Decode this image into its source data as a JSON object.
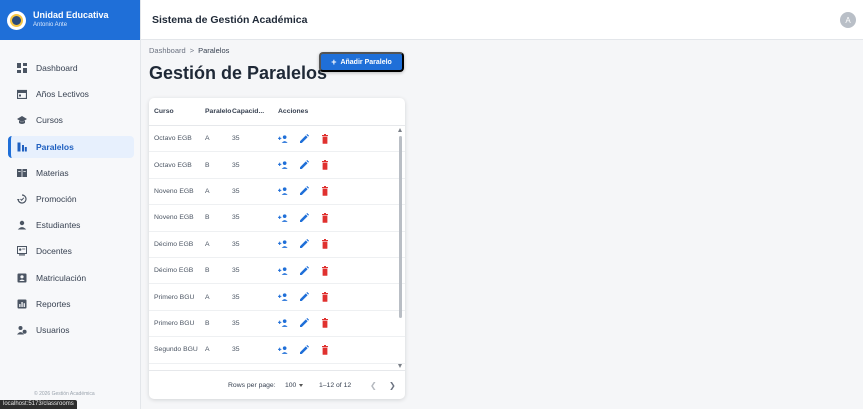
{
  "brand": {
    "title": "Unidad Educativa",
    "subtitle": "Antonio Ante"
  },
  "header": {
    "title": "Sistema de Gestión Académica",
    "avatar_initial": "A"
  },
  "sidebar": {
    "items": [
      {
        "label": "Dashboard",
        "icon": "dashboard-icon"
      },
      {
        "label": "Años Lectivos",
        "icon": "calendar-icon"
      },
      {
        "label": "Cursos",
        "icon": "school-icon"
      },
      {
        "label": "Paralelos",
        "icon": "classroom-icon",
        "active": true
      },
      {
        "label": "Materias",
        "icon": "book-icon"
      },
      {
        "label": "Promoción",
        "icon": "promotion-icon"
      },
      {
        "label": "Estudiantes",
        "icon": "student-icon"
      },
      {
        "label": "Docentes",
        "icon": "teacher-icon"
      },
      {
        "label": "Matriculación",
        "icon": "enrollment-icon"
      },
      {
        "label": "Reportes",
        "icon": "reports-icon"
      },
      {
        "label": "Usuarios",
        "icon": "users-icon"
      }
    ],
    "footer": "© 2026 Gestión Académica"
  },
  "breadcrumb": {
    "root": "Dashboard",
    "separator": ">",
    "current": "Paralelos"
  },
  "page": {
    "title": "Gestión de Paralelos",
    "add_button": "Añadir Paralelo"
  },
  "table": {
    "headers": {
      "curso": "Curso",
      "paralelo": "Paralelo",
      "capacidad": "Capacid...",
      "acciones": "Acciones"
    },
    "rows": [
      {
        "curso": "Octavo EGB",
        "paralelo": "A",
        "capacidad": "35"
      },
      {
        "curso": "Octavo EGB",
        "paralelo": "B",
        "capacidad": "35"
      },
      {
        "curso": "Noveno EGB",
        "paralelo": "A",
        "capacidad": "35"
      },
      {
        "curso": "Noveno EGB",
        "paralelo": "B",
        "capacidad": "35"
      },
      {
        "curso": "Décimo EGB",
        "paralelo": "A",
        "capacidad": "35"
      },
      {
        "curso": "Décimo EGB",
        "paralelo": "B",
        "capacidad": "35"
      },
      {
        "curso": "Primero BGU",
        "paralelo": "A",
        "capacidad": "35"
      },
      {
        "curso": "Primero BGU",
        "paralelo": "B",
        "capacidad": "35"
      },
      {
        "curso": "Segundo BGU",
        "paralelo": "A",
        "capacidad": "35"
      }
    ],
    "pagination": {
      "rows_label": "Rows per page:",
      "rows_value": "100",
      "range": "1–12 of 12"
    }
  },
  "status_bar": {
    "url": "localhost:5173/classrooms"
  },
  "colors": {
    "primary": "#1f6fd8",
    "danger": "#e0312f",
    "sidebar_active_bg": "#e7f0fd"
  }
}
